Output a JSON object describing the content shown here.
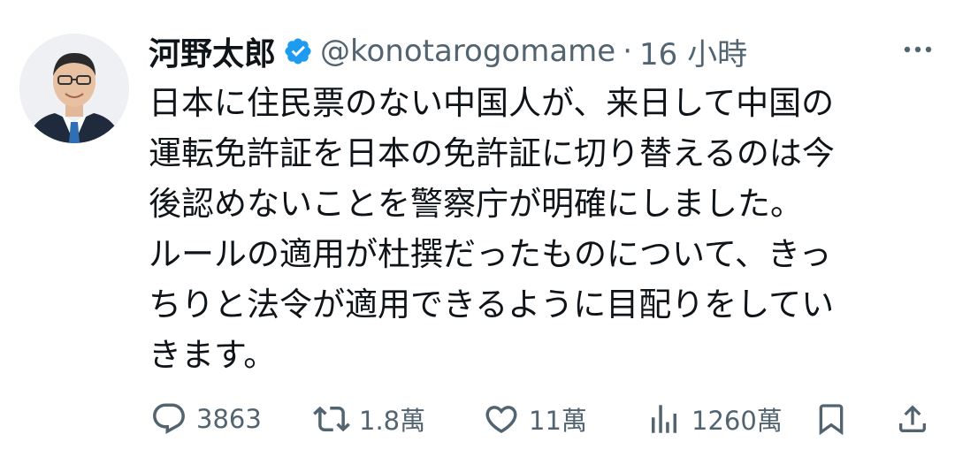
{
  "tweet": {
    "author": {
      "display_name": "河野太郎",
      "handle": "@konotarogomame",
      "verified_icon": "verified-badge-icon",
      "avatar": "profile-photo"
    },
    "separator": "·",
    "timestamp": "16 小時",
    "more_icon": "more-dots-icon",
    "text": "日本に住民票のない中国人が、来日して中国の\n運転免許証を日本の免許証に切り替えるのは今\n後認めないことを警察庁が明確にしました。\nルールの適用が杜撰だったものについて、きっ\nちりと法令が適用できるように目配りをしてい\nきます。",
    "actions": {
      "reply": {
        "icon": "reply-icon",
        "count": "3863"
      },
      "retweet": {
        "icon": "retweet-icon",
        "count": "1.8萬"
      },
      "like": {
        "icon": "like-icon",
        "count": "11萬"
      },
      "views": {
        "icon": "views-icon",
        "count": "1260萬"
      },
      "bookmark": {
        "icon": "bookmark-icon"
      },
      "share": {
        "icon": "share-icon"
      }
    }
  },
  "colors": {
    "text": "#0f1419",
    "secondary": "#536471",
    "verified": "#1d9bf0",
    "background": "#ffffff"
  }
}
